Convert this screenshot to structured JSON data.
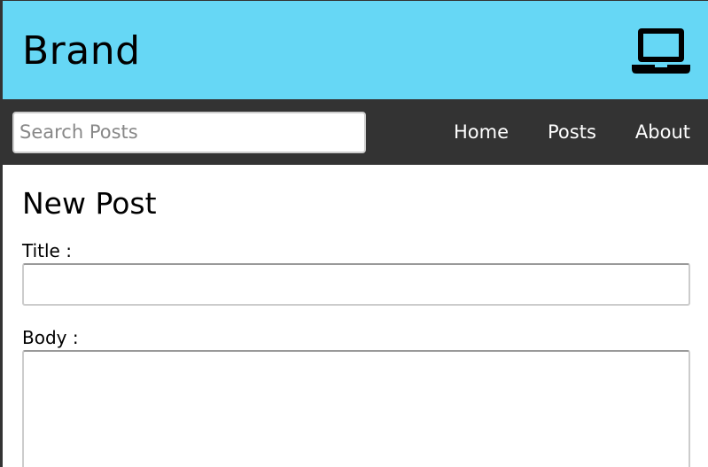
{
  "header": {
    "brand": "Brand",
    "icon": "laptop-icon",
    "background_color": "#66d7f5"
  },
  "navbar": {
    "background_color": "#333333",
    "search": {
      "placeholder": "Search Posts",
      "value": ""
    },
    "links": [
      {
        "label": "Home"
      },
      {
        "label": "Posts"
      },
      {
        "label": "About"
      }
    ]
  },
  "main": {
    "title": "New Post",
    "form": {
      "title_label": "Title :",
      "title_value": "",
      "body_label": "Body :",
      "body_value": ""
    }
  }
}
